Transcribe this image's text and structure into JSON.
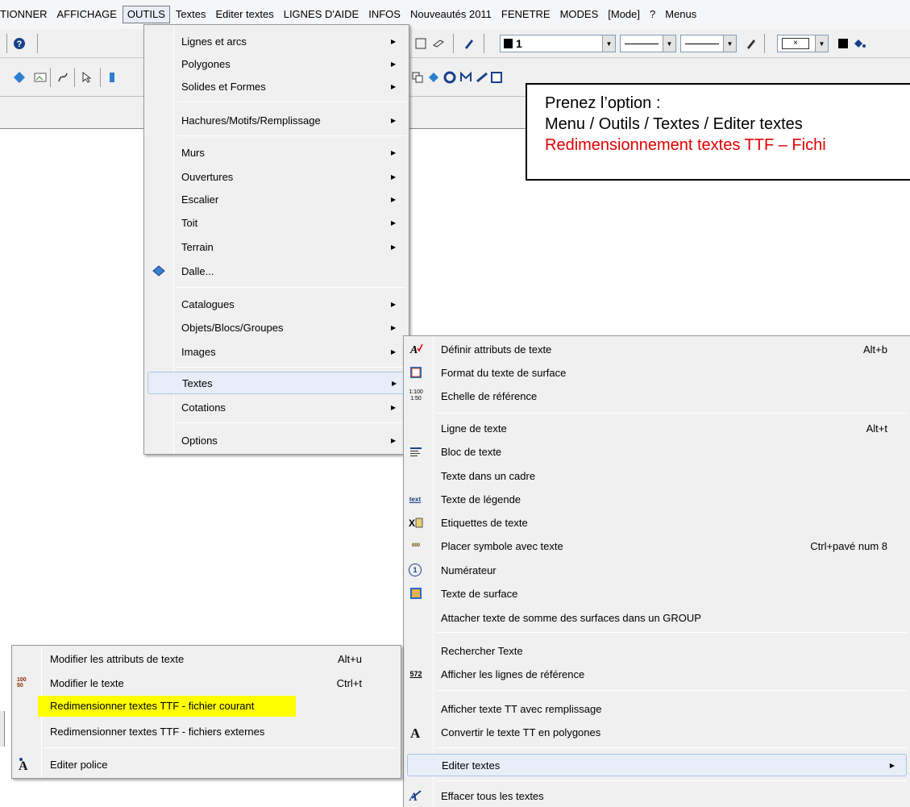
{
  "menubar": {
    "items": [
      "TIONNER",
      "AFFICHAGE",
      "OUTILS",
      "Textes",
      "Editer textes",
      "LIGNES D'AIDE",
      "INFOS",
      "Nouveautés 2011",
      "FENETRE",
      "MODES",
      "[Mode]",
      "?",
      "Menus"
    ],
    "active_index": 2
  },
  "toolbar": {
    "color_combo_value": "1"
  },
  "outils_menu": {
    "items": [
      {
        "label": "Lignes et arcs",
        "submenu": true
      },
      {
        "label": "Polygones",
        "submenu": true
      },
      {
        "label": "Solides et Formes",
        "submenu": true
      },
      {
        "label": "Hachures/Motifs/Remplissage",
        "submenu": true
      },
      {
        "label": "Murs",
        "submenu": true
      },
      {
        "label": "Ouvertures",
        "submenu": true
      },
      {
        "label": "Escalier",
        "submenu": true
      },
      {
        "label": "Toit",
        "submenu": true
      },
      {
        "label": "Terrain",
        "submenu": true
      },
      {
        "label": "Dalle...",
        "submenu": false
      },
      {
        "label": "Catalogues",
        "submenu": true
      },
      {
        "label": "Objets/Blocs/Groupes",
        "submenu": true
      },
      {
        "label": "Images",
        "submenu": true
      },
      {
        "label": "Textes",
        "submenu": true
      },
      {
        "label": "Cotations",
        "submenu": true
      },
      {
        "label": "Options",
        "submenu": true
      }
    ]
  },
  "textes_menu": {
    "items": [
      {
        "label": "Définir attributs de texte",
        "shortcut": "Alt+b"
      },
      {
        "label": "Format du texte de surface",
        "shortcut": ""
      },
      {
        "label": "Echelle de référence",
        "shortcut": ""
      },
      {
        "label": "Ligne de texte",
        "shortcut": "Alt+t"
      },
      {
        "label": "Bloc de texte",
        "shortcut": ""
      },
      {
        "label": "Texte dans un cadre",
        "shortcut": ""
      },
      {
        "label": "Texte de légende",
        "shortcut": ""
      },
      {
        "label": "Etiquettes de texte",
        "shortcut": ""
      },
      {
        "label": "Placer symbole avec texte",
        "shortcut": "Ctrl+pavé num 8"
      },
      {
        "label": "Numérateur",
        "shortcut": ""
      },
      {
        "label": "Texte de surface",
        "shortcut": ""
      },
      {
        "label": "Attacher texte de somme des surfaces dans un GROUP",
        "shortcut": ""
      },
      {
        "label": "Rechercher Texte",
        "shortcut": ""
      },
      {
        "label": "Afficher les lignes de référence",
        "shortcut": ""
      },
      {
        "label": "Afficher texte TT avec remplissage",
        "shortcut": ""
      },
      {
        "label": "Convertir le texte TT en polygones",
        "shortcut": ""
      },
      {
        "label": "Editer textes",
        "shortcut": ""
      },
      {
        "label": "Effacer tous les textes",
        "shortcut": ""
      }
    ]
  },
  "editer_menu": {
    "items": [
      {
        "label": "Modifier les attributs de texte",
        "shortcut": "Alt+u"
      },
      {
        "label": "Modifier le texte",
        "shortcut": "Ctrl+t"
      },
      {
        "label": "Redimensionner textes TTF - fichier courant",
        "shortcut": ""
      },
      {
        "label": "Redimensionner textes TTF - fichiers externes",
        "shortcut": ""
      },
      {
        "label": "Editer police",
        "shortcut": ""
      }
    ]
  },
  "callout": {
    "line1": "Prenez l’option :",
    "line2": "Menu / Outils / Textes / Editer textes",
    "line3": "Redimensionnement textes TTF – Fichi"
  },
  "icon_text": {
    "echelle": "1:100 1:50",
    "legende": "text",
    "placer": "000",
    "numerateur": "1",
    "modifier": "100 50",
    "lignes_ref": "572"
  },
  "colors": {
    "highlight_yellow": "#ffff00",
    "callout_red": "#e00000",
    "menu_bg": "#f0f0f0",
    "hover_bg": "#e7eef8"
  }
}
